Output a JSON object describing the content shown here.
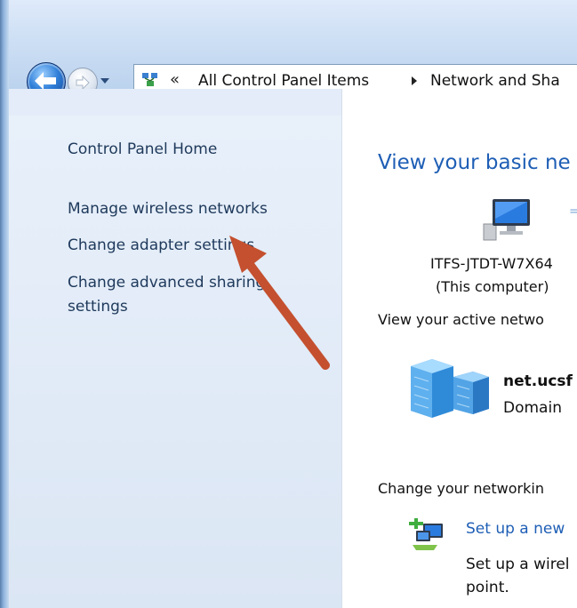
{
  "address_bar": {
    "overflow_chevron": "«",
    "crumbs": [
      "All Control Panel Items",
      "Network and Sha"
    ]
  },
  "sidebar": {
    "home_link": "Control Panel Home",
    "links": [
      {
        "label": "Manage wireless networks"
      },
      {
        "label": "Change adapter settings"
      },
      {
        "label_line1": "Change advanced sharing",
        "label_line2": "settings"
      }
    ]
  },
  "main": {
    "title": "View your basic ne",
    "computer": {
      "name": "ITFS-JTDT-W7X64",
      "subtitle": "(This computer)"
    },
    "active_networks_label": "View your active netwo",
    "network": {
      "name": "net.ucsf",
      "type": "Domain"
    },
    "change_settings_label": "Change your networkin",
    "setup": {
      "link": "Set up a new",
      "desc_line1": "Set up a wirel",
      "desc_line2": "point."
    }
  },
  "colors": {
    "link": "#1e5eb5",
    "sidebar_link": "#1e395b",
    "annotation_arrow": "#c4502f"
  },
  "icons": [
    "back-arrow-icon",
    "forward-arrow-icon",
    "control-panel-icon",
    "computer-icon",
    "domain-network-icon",
    "network-setup-icon"
  ]
}
